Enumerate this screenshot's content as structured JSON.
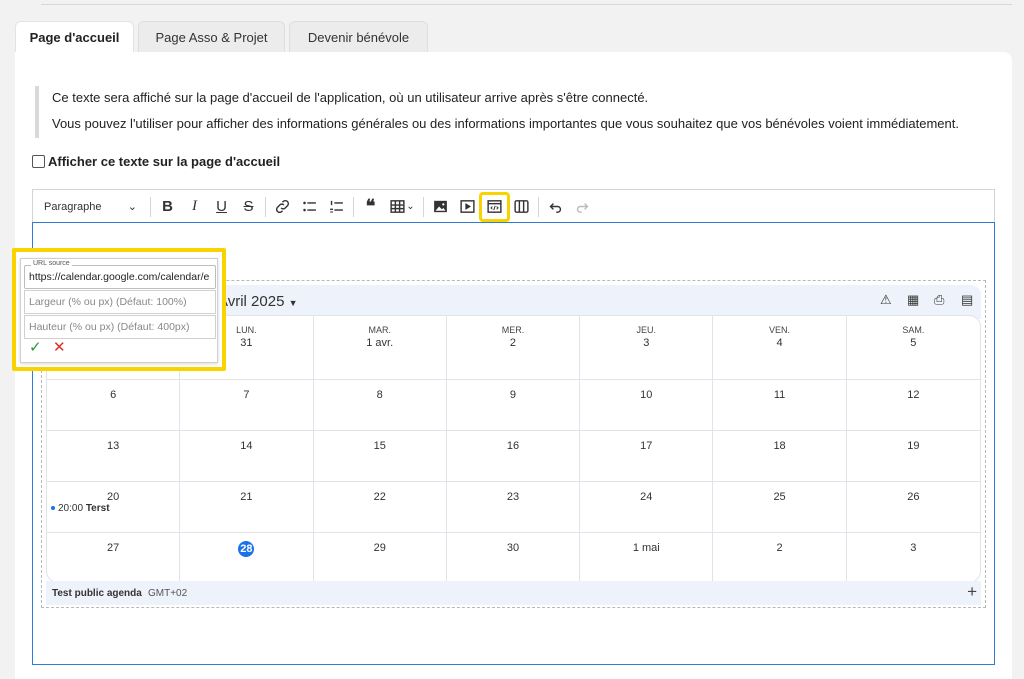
{
  "tabs": [
    {
      "label": "Page d'accueil",
      "active": true
    },
    {
      "label": "Page Asso & Projet",
      "active": false
    },
    {
      "label": "Devenir bénévole",
      "active": false
    }
  ],
  "info": {
    "line1": "Ce texte sera affiché sur la page d'accueil de l'application, où un utilisateur arrive après s'être connecté.",
    "line2": "Vous pouvez l'utiliser pour afficher des informations générales ou des informations importantes que vous souhaitez que vos bénévoles voient immédiatement."
  },
  "checkbox_label": "Afficher ce texte sur la page d'accueil",
  "toolbar": {
    "format_label": "Paragraphe",
    "highlight_color": "#f8d300"
  },
  "calendar": {
    "month": "Avril 2025",
    "calendar_name": "Test public agenda",
    "timezone": "GMT+02",
    "weekdays": [
      "",
      "LUN.",
      "MAR.",
      "MER.",
      "JEU.",
      "VEN.",
      "SAM."
    ],
    "first_row": [
      "",
      "31",
      "1 avr.",
      "2",
      "3",
      "4",
      "5"
    ],
    "rows": [
      [
        "6",
        "7",
        "8",
        "9",
        "10",
        "11",
        "12"
      ],
      [
        "13",
        "14",
        "15",
        "16",
        "17",
        "18",
        "19"
      ],
      [
        "20",
        "21",
        "22",
        "23",
        "24",
        "25",
        "26"
      ],
      [
        "27",
        "28",
        "29",
        "30",
        "1 mai",
        "2",
        "3"
      ]
    ],
    "today": "28",
    "event": {
      "time": "20:00",
      "title": "Terst"
    }
  },
  "popover": {
    "url_legend": "URL source",
    "url_value": "https://calendar.google.com/calendar/e",
    "width_placeholder": "Largeur (% ou px) (Défaut: 100%)",
    "height_placeholder": "Hauteur (% ou px) (Défaut: 400px)"
  }
}
